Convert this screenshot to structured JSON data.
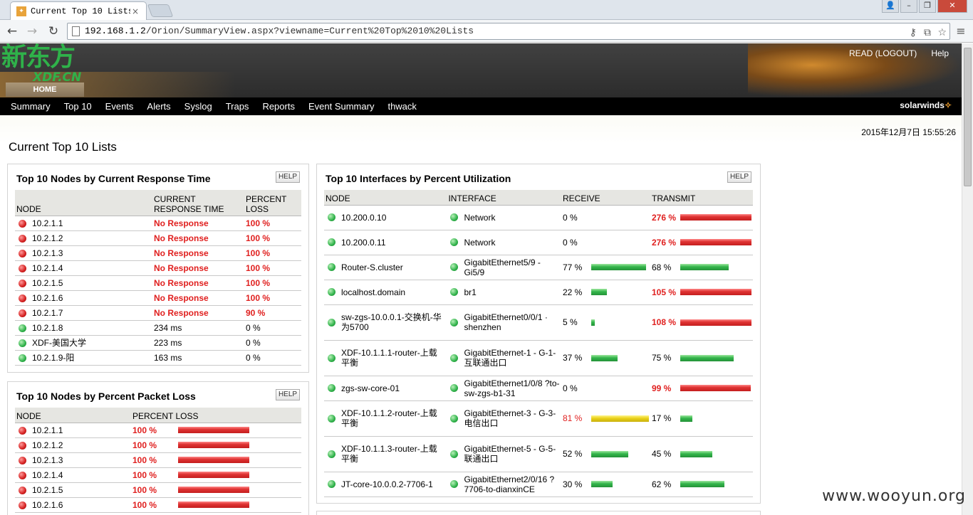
{
  "browser": {
    "tab_title": "Current Top 10 Lists",
    "url_host": "192.168.1.2",
    "url_path": "/Orion/SummaryView.aspx?viewname=Current%20Top%2010%20Lists"
  },
  "header": {
    "logo_cn": "新东方",
    "logo_en": "XDF.CN",
    "user_link": "READ (LOGOUT)",
    "help_link": "Help",
    "home_tab": "HOME",
    "brand": "solarwinds",
    "nav": [
      "Summary",
      "Top 10",
      "Events",
      "Alerts",
      "Syslog",
      "Traps",
      "Reports",
      "Event Summary",
      "thwack"
    ]
  },
  "page": {
    "datetime": "2015年12月7日 15:55:26",
    "title": "Current Top 10 Lists"
  },
  "panels": {
    "help_label": "HELP",
    "response": {
      "title": "Top 10 Nodes by Current Response Time",
      "columns": [
        "NODE",
        "CURRENT RESPONSE TIME",
        "PERCENT LOSS"
      ],
      "rows": [
        {
          "status": "down",
          "node": "10.2.1.1",
          "resp": "No Response",
          "loss": "100 %"
        },
        {
          "status": "down",
          "node": "10.2.1.2",
          "resp": "No Response",
          "loss": "100 %"
        },
        {
          "status": "down",
          "node": "10.2.1.3",
          "resp": "No Response",
          "loss": "100 %"
        },
        {
          "status": "down",
          "node": "10.2.1.4",
          "resp": "No Response",
          "loss": "100 %"
        },
        {
          "status": "down",
          "node": "10.2.1.5",
          "resp": "No Response",
          "loss": "100 %"
        },
        {
          "status": "down",
          "node": "10.2.1.6",
          "resp": "No Response",
          "loss": "100 %"
        },
        {
          "status": "down",
          "node": "10.2.1.7",
          "resp": "No Response",
          "loss": "90 %"
        },
        {
          "status": "up",
          "node": "10.2.1.8",
          "resp": "234 ms",
          "loss": "0 %"
        },
        {
          "status": "up",
          "node": "XDF-美国大学",
          "resp": "223 ms",
          "loss": "0 %"
        },
        {
          "status": "up",
          "node": "10.2.1.9-阳",
          "resp": "163 ms",
          "loss": "0 %"
        }
      ]
    },
    "loss": {
      "title": "Top 10 Nodes by Percent Packet Loss",
      "columns": [
        "NODE",
        "PERCENT LOSS"
      ],
      "rows": [
        {
          "status": "down",
          "node": "10.2.1.1",
          "loss": "100 %",
          "loss_pct": 100
        },
        {
          "status": "down",
          "node": "10.2.1.2",
          "loss": "100 %",
          "loss_pct": 100
        },
        {
          "status": "down",
          "node": "10.2.1.3",
          "loss": "100 %",
          "loss_pct": 100
        },
        {
          "status": "down",
          "node": "10.2.1.4",
          "loss": "100 %",
          "loss_pct": 100
        },
        {
          "status": "down",
          "node": "10.2.1.5",
          "loss": "100 %",
          "loss_pct": 100
        },
        {
          "status": "down",
          "node": "10.2.1.6",
          "loss": "100 %",
          "loss_pct": 100
        }
      ]
    },
    "interfaces": {
      "title": "Top 10 Interfaces by Percent Utilization",
      "columns": [
        "NODE",
        "INTERFACE",
        "RECEIVE",
        "TRANSMIT"
      ],
      "rows": [
        {
          "node": "10.200.0.10",
          "iface": "Network",
          "rx": "0 %",
          "rx_pct": 0,
          "rx_hot": false,
          "tx": "276 %",
          "tx_pct": 100,
          "tx_hot": true
        },
        {
          "node": "10.200.0.11",
          "iface": "Network",
          "rx": "0 %",
          "rx_pct": 0,
          "rx_hot": false,
          "tx": "276 %",
          "tx_pct": 100,
          "tx_hot": true
        },
        {
          "node": "Router-S.cluster",
          "iface": "GigabitEthernet5/9 - Gi5/9",
          "rx": "77 %",
          "rx_pct": 77,
          "rx_hot": false,
          "tx": "68 %",
          "tx_pct": 68,
          "tx_hot": false
        },
        {
          "node": "localhost.domain",
          "iface": "br1",
          "rx": "22 %",
          "rx_pct": 22,
          "rx_hot": false,
          "tx": "105 %",
          "tx_pct": 100,
          "tx_hot": true
        },
        {
          "node": "sw-zgs-10.0.0.1-交换机-华为5700",
          "iface": "GigabitEthernet0/0/1 · shenzhen",
          "rx": "5 %",
          "rx_pct": 5,
          "rx_hot": false,
          "tx": "108 %",
          "tx_pct": 100,
          "tx_hot": true
        },
        {
          "node": "XDF-10.1.1.1-router-上载平衡",
          "iface": "GigabitEthernet-1 - G-1-互联通出口",
          "rx": "37 %",
          "rx_pct": 37,
          "rx_hot": false,
          "tx": "75 %",
          "tx_pct": 75,
          "tx_hot": false
        },
        {
          "node": "zgs-sw-core-01",
          "iface": "GigabitEthernet1/0/8 ?to-sw-zgs-b1-31",
          "rx": "0 %",
          "rx_pct": 0,
          "rx_hot": false,
          "tx": "99 %",
          "tx_pct": 99,
          "tx_hot": true
        },
        {
          "node": "XDF-10.1.1.2-router-上载平衡",
          "iface": "GigabitEthernet-3 - G-3-电信出口",
          "rx": "81 %",
          "rx_pct": 81,
          "rx_hot": true,
          "tx": "17 %",
          "tx_pct": 17,
          "tx_hot": false
        },
        {
          "node": "XDF-10.1.1.3-router-上载平衡",
          "iface": "GigabitEthernet-5 - G-5-联通出口",
          "rx": "52 %",
          "rx_pct": 52,
          "rx_hot": false,
          "tx": "45 %",
          "tx_pct": 45,
          "tx_hot": false
        },
        {
          "node": "JT-core-10.0.0.2-7706-1",
          "iface": "GigabitEthernet2/0/16 ?7706-to-dianxinCE",
          "rx": "30 %",
          "rx_pct": 30,
          "rx_hot": false,
          "tx": "62 %",
          "tx_pct": 62,
          "tx_hot": false
        }
      ]
    }
  },
  "watermark": "www.wooyun.org"
}
